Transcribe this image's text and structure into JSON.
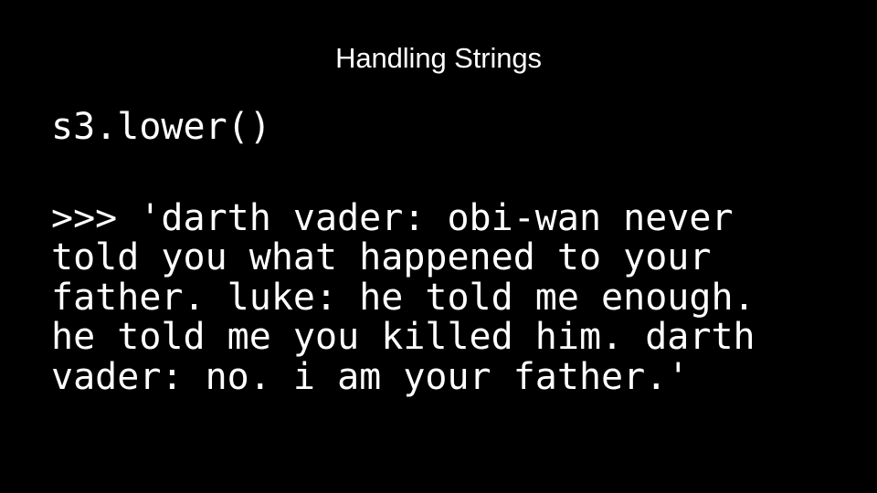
{
  "slide": {
    "title": "Handling Strings",
    "background_color": "#000000",
    "text_color": "#ffffff"
  },
  "code": {
    "statement": "s3.lower()"
  },
  "output": {
    "lines": [
      ">>> 'darth vader: obi-wan never",
      "told you what happened to your",
      "father. luke: he told me enough.",
      "he told me you killed him. darth",
      "vader: no. i am your father.'"
    ]
  }
}
